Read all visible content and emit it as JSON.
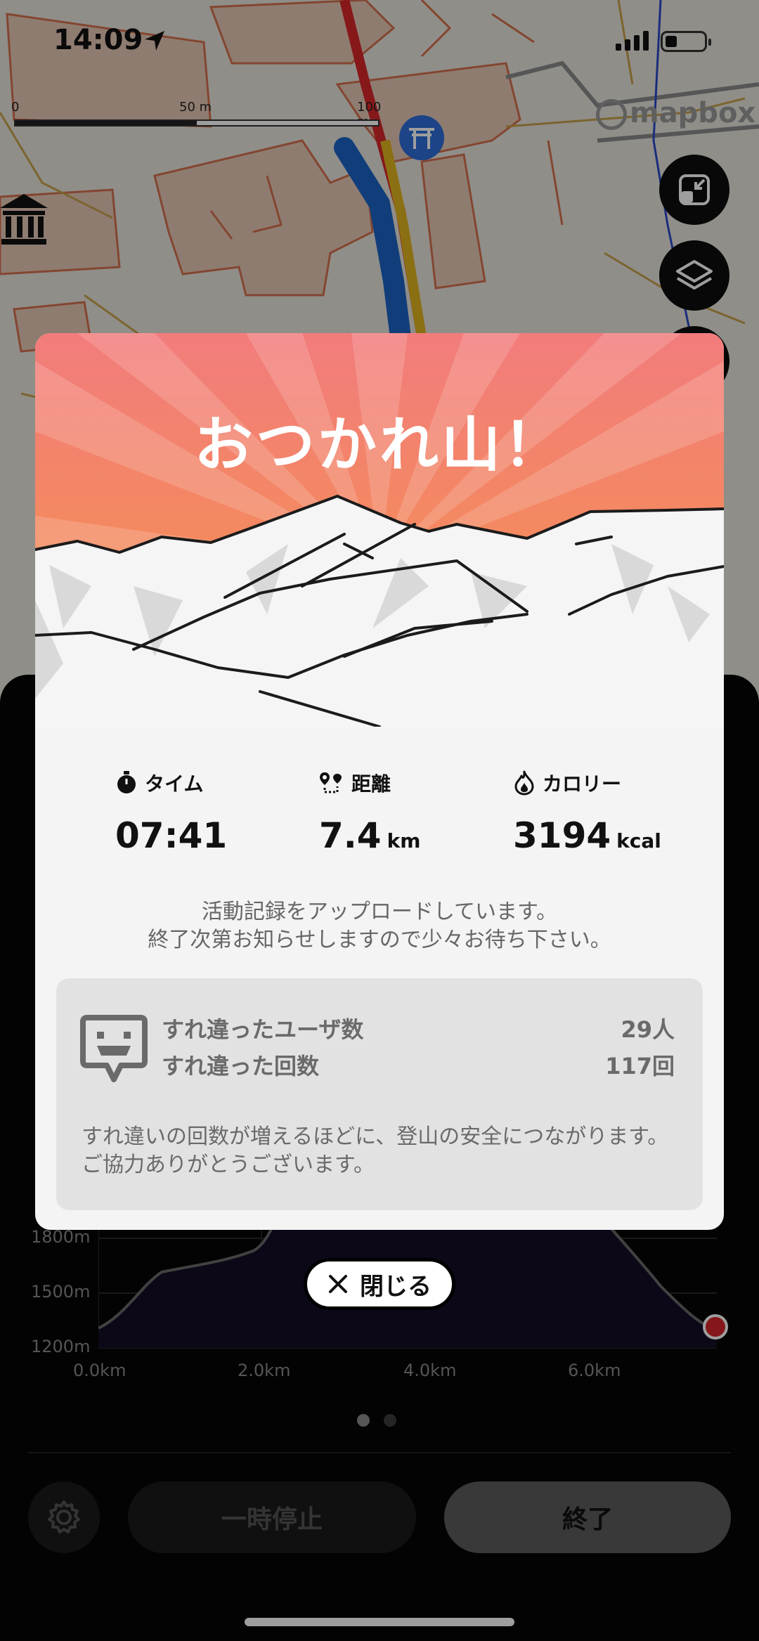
{
  "status_bar": {
    "time": "14:09"
  },
  "map": {
    "scale_ticks": [
      "0",
      "50 m",
      "100 m"
    ],
    "attribution": "mapbox",
    "buttons": [
      {
        "icon": "shrink-icon"
      },
      {
        "icon": "layers-icon"
      }
    ]
  },
  "modal": {
    "title": "おつかれ山！",
    "stats": {
      "time": {
        "label": "タイム",
        "value": "07:41",
        "unit": "",
        "icon": "stopwatch-icon"
      },
      "distance": {
        "label": "距離",
        "value": "7.4",
        "unit": "km",
        "icon": "route-icon"
      },
      "calories": {
        "label": "カロリー",
        "value": "3194",
        "unit": "kcal",
        "icon": "flame-icon"
      }
    },
    "upload_line1": "活動記録をアップロードしています。",
    "upload_line2": "終了次第お知らせしますので少々お待ち下さい。",
    "passing": {
      "users_label": "すれ違ったユーザ数",
      "users_value": "29人",
      "count_label": "すれ違った回数",
      "count_value": "117回",
      "note": "すれ違いの回数が増えるほどに、登山の安全につながります。ご協力ありがとうございます。"
    },
    "close_label": "閉じる"
  },
  "elevation_chart": {
    "y_ticks": [
      "1800m",
      "1500m",
      "1200m"
    ],
    "x_ticks": [
      "0.0km",
      "2.0km",
      "4.0km",
      "6.0km"
    ]
  },
  "pager": {
    "count": 2,
    "active": 0
  },
  "controls": {
    "pause_label": "一時停止",
    "end_label": "終了"
  }
}
